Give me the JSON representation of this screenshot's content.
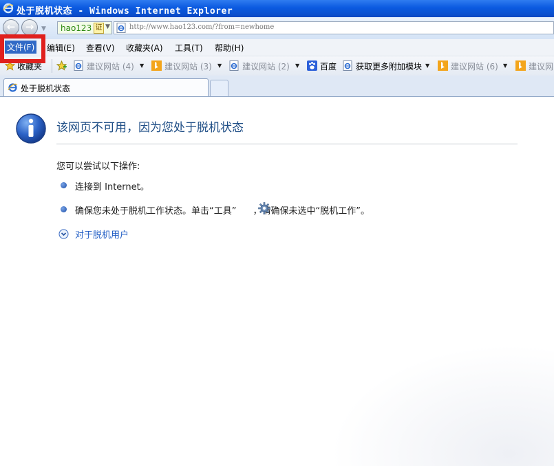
{
  "window": {
    "title": "处于脱机状态 - Windows Internet Explorer"
  },
  "address_bar": {
    "site_name": "hao123",
    "site_badge": "证",
    "url": "http://www.hao123.com/?from=newhome"
  },
  "menu": {
    "items": [
      {
        "label": "文件(F)",
        "active": true
      },
      {
        "label": "编辑(E)"
      },
      {
        "label": "查看(V)"
      },
      {
        "label": "收藏夹(A)"
      },
      {
        "label": "工具(T)"
      },
      {
        "label": "帮助(H)"
      }
    ]
  },
  "favorites_bar": {
    "favorites_label": "收藏夹",
    "items": [
      {
        "label": "建议网站 (4)",
        "icon": "ie-icon"
      },
      {
        "label": "建议网站 (3)",
        "icon": "bing-icon"
      },
      {
        "label": "建议网站 (2)",
        "icon": "ie-icon"
      },
      {
        "label": "百度",
        "icon": "baidu-icon"
      },
      {
        "label": "获取更多附加模块",
        "icon": "ie-icon"
      },
      {
        "label": "建议网站 (6)",
        "icon": "bing-icon"
      },
      {
        "label": "建议网",
        "icon": "bing-icon"
      }
    ]
  },
  "tab": {
    "label": "处于脱机状态"
  },
  "content": {
    "headline": "该网页不可用，因为您处于脱机状态",
    "subheading": "您可以尝试以下操作:",
    "bullets": [
      "连接到 Internet。",
      "确保您未处于脱机工作状态。单击“工具”",
      "，请确保未选中“脱机工作”。"
    ],
    "link": "对于脱机用户"
  },
  "colors": {
    "title_bar": "#0b5ae0",
    "highlight_box": "#e0201d",
    "headline": "#1f4e86",
    "link": "#1f5cc4"
  }
}
